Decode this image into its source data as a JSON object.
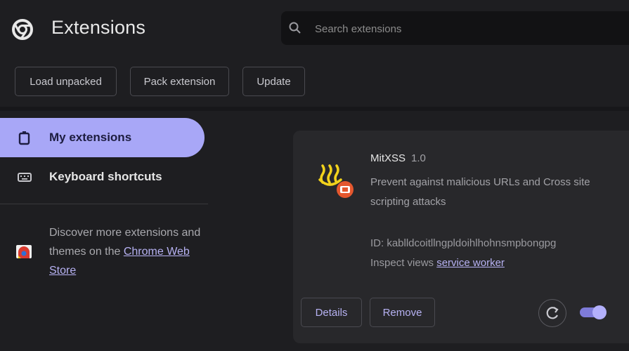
{
  "header": {
    "title": "Extensions",
    "logo_icon": "chrome-logo-icon"
  },
  "search": {
    "placeholder": "Search extensions",
    "icon": "search-icon"
  },
  "toolbar": {
    "load_unpacked_label": "Load unpacked",
    "pack_extension_label": "Pack extension",
    "update_label": "Update"
  },
  "sidebar": {
    "items": [
      {
        "label": "My extensions",
        "icon": "puzzle-icon",
        "active": true
      },
      {
        "label": "Keyboard shortcuts",
        "icon": "keyboard-icon",
        "active": false
      }
    ],
    "discover_prefix": "Discover more extensions and themes on the ",
    "discover_link": "Chrome Web Store",
    "store_icon": "web-store-icon"
  },
  "extension": {
    "name": "MitXSS",
    "version": "1.0",
    "description": "Prevent against malicious URLs and Cross site scripting attacks",
    "id_text": "ID: kablldcoitllngpldoihlhohnsmpbongpg",
    "inspect_prefix": "Inspect views",
    "inspect_link": "service worker",
    "details_label": "Details",
    "remove_label": "Remove",
    "enabled": true
  },
  "colors": {
    "accent": "#a8a7f7",
    "link": "#b7b2f3",
    "background": "#1e1e21",
    "card": "#28282b"
  }
}
